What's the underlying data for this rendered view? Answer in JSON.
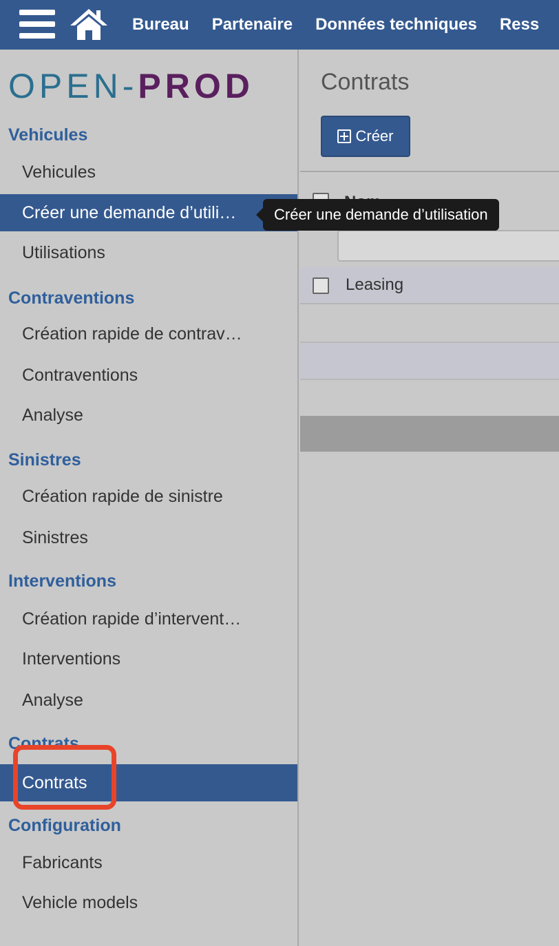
{
  "topbar": {
    "menu": [
      "Bureau",
      "Partenaire",
      "Données techniques",
      "Ress"
    ]
  },
  "logo": {
    "part1": "OPEN-",
    "part2": "PROD"
  },
  "sidebar": {
    "sections": {
      "vehicules": "Vehicules",
      "contraventions": "Contraventions",
      "sinistres": "Sinistres",
      "interventions": "Interventions",
      "contrats": "Contrats",
      "configuration": "Configuration"
    },
    "items": {
      "vehicules": "Vehicules",
      "creer_demande": "Créer une demande d’utili…",
      "utilisations": "Utilisations",
      "creation_contrav": "Création rapide de contrav…",
      "contraventions": "Contraventions",
      "analyse1": "Analyse",
      "creation_sinistre": "Création rapide de sinistre",
      "sinistres": "Sinistres",
      "creation_intervent": "Création rapide d’intervent…",
      "interventions": "Interventions",
      "analyse2": "Analyse",
      "contrats": "Contrats",
      "fabricants": "Fabricants",
      "vehicle_models": "Vehicle models"
    }
  },
  "tooltip": {
    "text": "Créer une demande d’utilisation"
  },
  "main": {
    "title": "Contrats",
    "create_label": "Créer",
    "column_name": "Nom",
    "filter_value": "",
    "rows": [
      "Leasing"
    ]
  },
  "colors": {
    "primary": "#34598f",
    "section": "#2f5f9c",
    "highlight": "#e8442a",
    "logo_open": "#2a6f8f",
    "logo_prod": "#5a1f5e"
  }
}
